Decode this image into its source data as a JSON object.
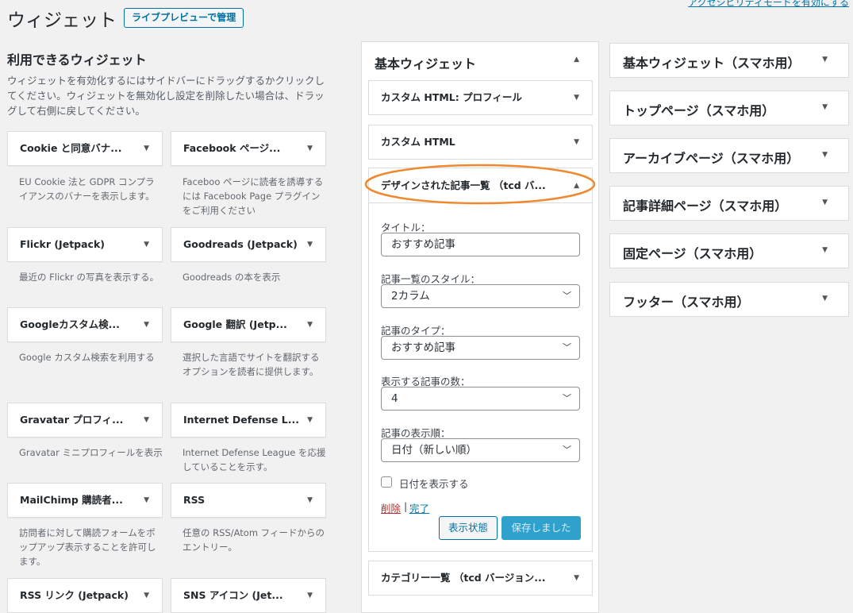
{
  "header": {
    "title": "ウィジェット",
    "live_preview_button": "ライブプレビューで管理",
    "accessibility_link": "アクセシビリティモードを有効にする"
  },
  "available": {
    "heading": "利用できるウィジェット",
    "description": "ウィジェットを有効化するにはサイドバーにドラッグするかクリックしてください。ウィジェットを無効化し設定を削除したい場合は、ドラッグして右側に戻してください。",
    "widgets": [
      {
        "title": "Cookie と同意バナ...",
        "desc": "EU Cookie 法と GDPR コンプライアンスのバナーを表示します。"
      },
      {
        "title": "Facebook ページ...",
        "desc": "Faceboo ページに読者を誘導するには Facebook Page プラグインをご利用ください"
      },
      {
        "title": "Flickr (Jetpack)",
        "desc": "最近の Flickr の写真を表示する。"
      },
      {
        "title": "Goodreads (Jetpack)",
        "desc": "Goodreads の本を表示"
      },
      {
        "title": "Googleカスタム検...",
        "desc": "Google カスタム検索を利用する"
      },
      {
        "title": "Google 翻訳 (Jetp...",
        "desc": "選択した言語でサイトを翻訳するオプションを読者に提供します。"
      },
      {
        "title": "Gravatar プロフィ...",
        "desc": "Gravatar ミニプロフィールを表示"
      },
      {
        "title": "Internet Defense L...",
        "desc": "Internet Defense League を応援していることを示す。"
      },
      {
        "title": "MailChimp 購読者...",
        "desc": "訪問者に対して購読フォームをポップアップ表示することを許可します。"
      },
      {
        "title": "RSS",
        "desc": "任意の RSS/Atom フィードからのエントリー。"
      },
      {
        "title": "RSS リンク (Jetpack)",
        "desc": ""
      },
      {
        "title": "SNS アイコン (Jet...",
        "desc": ""
      }
    ]
  },
  "sidebar_main": {
    "title": "基本ウィジェット",
    "widgets": [
      "カスタム HTML: プロフィール",
      "カスタム HTML",
      "デザインされた記事一覧 （tcd バ...",
      "カテゴリー一覧 （tcd バージョン..."
    ],
    "form": {
      "title_label": "タイトル：",
      "title_value": "おすすめ記事",
      "style_label": "記事一覧のスタイル：",
      "style_value": "2カラム",
      "type_label": "記事のタイプ：",
      "type_value": "おすすめ記事",
      "count_label": "表示する記事の数：",
      "count_value": "4",
      "order_label": "記事の表示順：",
      "order_value": "日付（新しい順）",
      "show_date_label": "日付を表示する",
      "delete_link": "削除",
      "separator": "|",
      "done_link": "完了",
      "visibility_button": "表示状態",
      "save_button": "保存しました"
    }
  },
  "right_sidebars": [
    "基本ウィジェット（スマホ用）",
    "トップページ（スマホ用）",
    "アーカイブページ（スマホ用）",
    "記事詳細ページ（スマホ用）",
    "固定ページ（スマホ用）",
    "フッター（スマホ用）"
  ],
  "colors": {
    "link": "#0073aa",
    "delete": "#b32d2e",
    "highlight_ellipse": "#f0882d",
    "primary_button": "#2ea2cc"
  },
  "icons": {
    "collapse": "triangle-down",
    "expand": "triangle-up"
  }
}
